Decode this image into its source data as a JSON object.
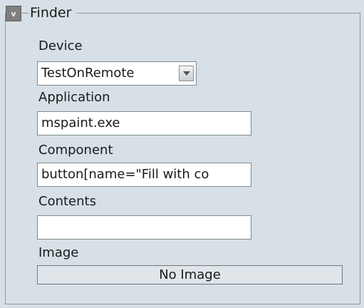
{
  "finder": {
    "title": "Finder",
    "collapse_glyph": "v",
    "device": {
      "label": "Device",
      "value": "TestOnRemote",
      "icon": "chevron-down-icon"
    },
    "application": {
      "label": "Application",
      "value": "mspaint.exe"
    },
    "component": {
      "label": "Component",
      "value": "button[name=\"Fill with co"
    },
    "contents": {
      "label": "Contents",
      "value": ""
    },
    "image": {
      "label": "Image",
      "placeholder": "No Image"
    }
  }
}
